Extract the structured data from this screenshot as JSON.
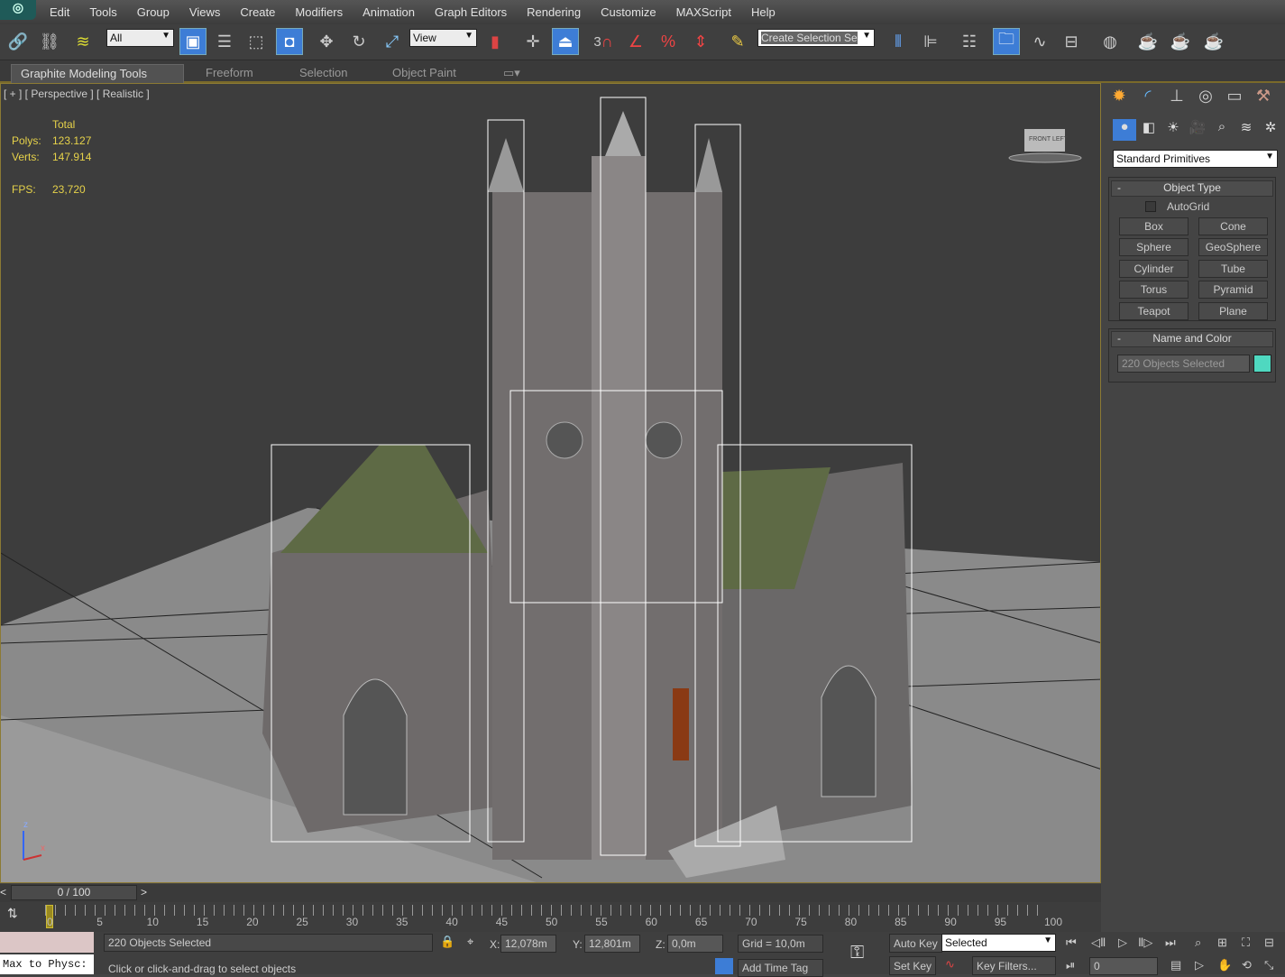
{
  "menu": [
    "Edit",
    "Tools",
    "Group",
    "Views",
    "Create",
    "Modifiers",
    "Animation",
    "Graph Editors",
    "Rendering",
    "Customize",
    "MAXScript",
    "Help"
  ],
  "toolbar": {
    "filter_value": "All",
    "refcoord_value": "View",
    "selection_set_placeholder": "Create Selection Se",
    "snap_angle_label": "3"
  },
  "ribbon": {
    "tabs": [
      "Graphite Modeling Tools",
      "Freeform",
      "Selection",
      "Object Paint"
    ]
  },
  "viewport": {
    "label": "[ + ] [ Perspective ] [ Realistic ]",
    "stats": {
      "header": "Total",
      "polys_label": "Polys:",
      "polys": "123.127",
      "verts_label": "Verts:",
      "verts": "147.914",
      "fps_label": "FPS:",
      "fps": "23,720"
    },
    "viewcube_labels": [
      "FRONT",
      "LEFT"
    ],
    "axis": {
      "z": "z",
      "x": "x"
    }
  },
  "command_panel": {
    "category": "Standard Primitives",
    "object_type": {
      "title": "Object Type",
      "autogrid": "AutoGrid",
      "buttons": [
        "Box",
        "Cone",
        "Sphere",
        "GeoSphere",
        "Cylinder",
        "Tube",
        "Torus",
        "Pyramid",
        "Teapot",
        "Plane"
      ]
    },
    "name_color": {
      "title": "Name and Color",
      "name": "220 Objects Selected",
      "color": "#4fd8c0"
    }
  },
  "timeslider": {
    "frame": "0 / 100",
    "prev": "<",
    "next": ">",
    "ticks": [
      "0",
      "5",
      "10",
      "15",
      "20",
      "25",
      "30",
      "35",
      "40",
      "45",
      "50",
      "55",
      "60",
      "65",
      "70",
      "75",
      "80",
      "85",
      "90",
      "95",
      "100"
    ]
  },
  "status": {
    "script_listener": "Max to Physc:",
    "selection": "220 Objects Selected",
    "prompt": "Click or click-and-drag to select objects",
    "x_label": "X:",
    "x": "12,078m",
    "y_label": "Y:",
    "y": "12,801m",
    "z_label": "Z:",
    "z": "0,0m",
    "grid": "Grid = 10,0m",
    "add_time_tag": "Add Time Tag",
    "auto_key": "Auto Key",
    "set_key": "Set Key",
    "key_mode": "Selected",
    "key_filters": "Key Filters...",
    "current_frame": "0"
  },
  "colors": {
    "accent": "#3d7dd6",
    "viewport_border": "#8c7a34",
    "stats": "#e6d24a"
  }
}
